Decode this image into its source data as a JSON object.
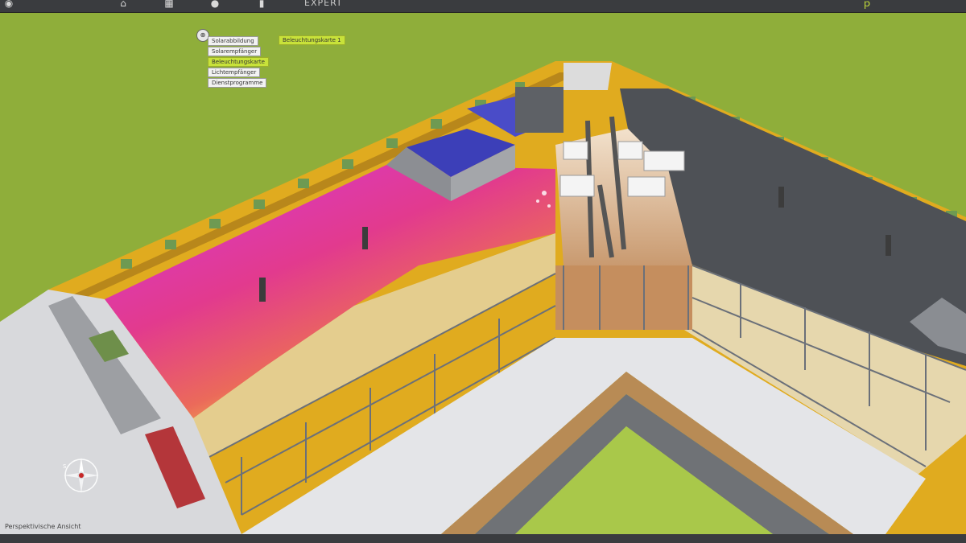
{
  "toolbar": {
    "mode_label": "EXPERT",
    "icons": [
      "home-icon",
      "grid-icon",
      "sun-icon",
      "trash-icon"
    ]
  },
  "menu": {
    "items": [
      {
        "label": "Solarabbildung",
        "active": false
      },
      {
        "label": "Solarempfänger",
        "active": false
      },
      {
        "label": "Beleuchtungskarte",
        "active": true
      },
      {
        "label": "Lichtempfänger",
        "active": false
      },
      {
        "label": "Dienstprogramme",
        "active": false
      }
    ],
    "submenu_label": "Beleuchtungskarte 1"
  },
  "view": {
    "label": "Perspektivische Ansicht"
  },
  "compass": {
    "labels": [
      "S",
      "O"
    ]
  },
  "colors": {
    "lawn": "#8fae3a",
    "parapet": "#e0ab1f",
    "roof_dark": "#4e5156",
    "heatmap_hot": "#e43bd0",
    "heatmap_warm": "#f0e14a",
    "menu_active": "#c8e23a"
  }
}
